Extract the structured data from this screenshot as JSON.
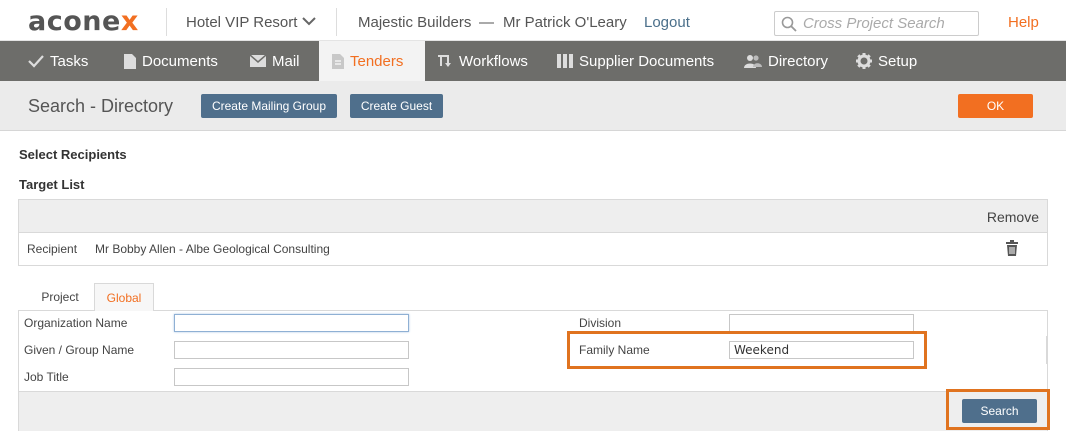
{
  "header": {
    "logo_prefix": "acone",
    "logo_suffix": "x",
    "project": "Hotel VIP Resort",
    "organization": "Majestic Builders",
    "separator": "—",
    "user": "Mr Patrick O'Leary",
    "logout": "Logout",
    "search_placeholder": "Cross Project Search",
    "help": "Help"
  },
  "nav": {
    "items": [
      {
        "label": "Tasks",
        "icon": "check-icon"
      },
      {
        "label": "Documents",
        "icon": "document-icon"
      },
      {
        "label": "Mail",
        "icon": "envelope-icon"
      },
      {
        "label": "Tenders",
        "icon": "tender-icon",
        "active": true
      },
      {
        "label": "Workflows",
        "icon": "workflow-icon"
      },
      {
        "label": "Supplier Documents",
        "icon": "binders-icon"
      },
      {
        "label": "Directory",
        "icon": "people-icon"
      },
      {
        "label": "Setup",
        "icon": "gear-icon"
      }
    ]
  },
  "subheader": {
    "title": "Search - Directory",
    "create_mailing_group": "Create Mailing Group",
    "create_guest": "Create Guest",
    "ok": "OK"
  },
  "select_recipients": "Select Recipients",
  "target_list": {
    "title": "Target List",
    "remove_header": "Remove",
    "rows": [
      {
        "type": "Recipient",
        "name": "Mr Bobby Allen - Albe Geological Consulting"
      }
    ]
  },
  "tabs": [
    {
      "label": "Project"
    },
    {
      "label": "Global",
      "active": true
    }
  ],
  "form": {
    "organization_name": {
      "label": "Organization Name",
      "value": ""
    },
    "given_group_name": {
      "label": "Given / Group Name",
      "value": ""
    },
    "job_title": {
      "label": "Job Title",
      "value": ""
    },
    "division": {
      "label": "Division",
      "value": ""
    },
    "family_name": {
      "label": "Family Name",
      "value": "Weekend"
    },
    "search_button": "Search"
  },
  "colors": {
    "accent": "#f26f21",
    "nav_bg": "#6d6d6a",
    "button_blue": "#4f6f8c",
    "highlight": "#e0731f"
  }
}
